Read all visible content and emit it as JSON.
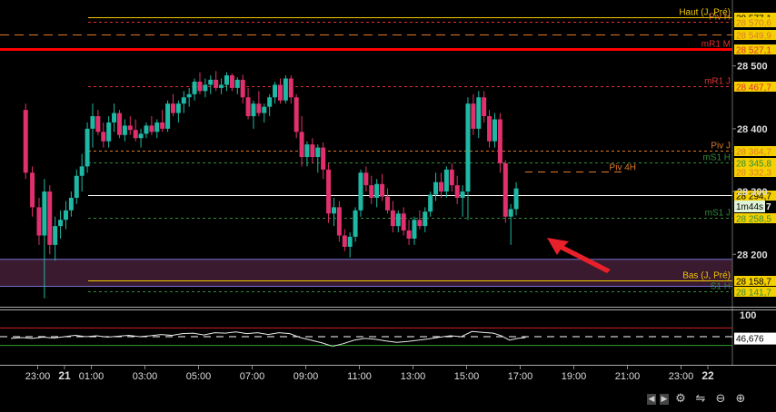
{
  "chart_data": {
    "type": "candlestick",
    "price_axis": {
      "ticks": [
        "28 500",
        "28 400",
        "28 300",
        "28 200"
      ],
      "tick_values": [
        28500,
        28400,
        28300,
        28200
      ],
      "range": [
        28118,
        28605
      ]
    },
    "time_axis": {
      "ticks": [
        "23:00",
        "21",
        "01:00",
        "03:00",
        "05:00",
        "07:00",
        "09:00",
        "11:00",
        "13:00",
        "15:00",
        "17:00",
        "19:00",
        "21:00",
        "23:00",
        "22"
      ],
      "tick_hours": [
        -1,
        0,
        1,
        3,
        5,
        7,
        9,
        11,
        13,
        15,
        17,
        19,
        21,
        23,
        24
      ],
      "bold_ticks": [
        "21",
        "22"
      ]
    },
    "levels": [
      {
        "label": "Haut (J, Pré)",
        "price": 28577.1,
        "tag": "28 577,1",
        "color": "#f0c800",
        "label_color": "#f0c800",
        "style": "solid"
      },
      {
        "label": "Piv H",
        "price": 28570.6,
        "tag": "28 570,6",
        "color": "#e03030",
        "label_color": "#e07a2a",
        "style": "dotted"
      },
      {
        "label": "",
        "price": 28549.9,
        "tag": "28 549,9",
        "color": "#e07a2a",
        "label_color": "#e07a2a",
        "style": "dashed"
      },
      {
        "label": "mR1 M",
        "price": 28527.1,
        "tag": "28 527,1",
        "color": "#ff0000",
        "label_color": "#e03030",
        "style": "thick"
      },
      {
        "label": "mR1 J",
        "price": 28467.7,
        "tag": "28 467,7",
        "color": "#e03030",
        "label_color": "#e03030",
        "style": "dotted"
      },
      {
        "label": "Piv J",
        "price": 28364.7,
        "tag": "28 364,7",
        "color": "#e07a2a",
        "label_color": "#e07a2a",
        "style": "dotted"
      },
      {
        "label": "mS1 H",
        "price": 28345.8,
        "tag": "28 345,8",
        "color": "#2e8b3a",
        "label_color": "#2e8b3a",
        "style": "dotted"
      },
      {
        "label": "Piv 4H",
        "price": 28332.3,
        "tag": "28 332,3",
        "color": "#e07a2a",
        "label_color": "#e07a2a",
        "style": "dashed_short"
      },
      {
        "label": "",
        "price": 28294.7,
        "tag": "28 294,7",
        "color": "#ffffff",
        "label_color": "#ffffff",
        "style": "solid"
      },
      {
        "label": "mS1 J",
        "price": 28258.5,
        "tag": "28 258,5",
        "color": "#2e8b3a",
        "label_color": "#2e8b3a",
        "style": "dotted"
      },
      {
        "label": "Bas (J, Pré)",
        "price": 28158.7,
        "tag": "28 158,7",
        "color": "#f0c800",
        "label_color": "#f0c800",
        "style": "solid"
      },
      {
        "label": "S1 H",
        "price": 28141.7,
        "tag": "28 141,7",
        "color": "#2e8b3a",
        "label_color": "#2e8b3a",
        "style": "dotted"
      }
    ],
    "countdown_tag": "1m44s",
    "zone": {
      "from": 28149,
      "to": 28192,
      "color": "#3a1a2e",
      "border": "#7070d0"
    },
    "arrow_color": "#e8202a",
    "candles": [
      [
        -1.45,
        28430,
        28440,
        28320,
        28330
      ],
      [
        -1.2,
        28330,
        28340,
        28260,
        28275
      ],
      [
        -0.95,
        28275,
        28290,
        28215,
        28230
      ],
      [
        -0.75,
        28230,
        28320,
        28130,
        28300
      ],
      [
        -0.55,
        28300,
        28310,
        28200,
        28215
      ],
      [
        -0.35,
        28215,
        28260,
        28190,
        28245
      ],
      [
        -0.15,
        28245,
        28270,
        28225,
        28255
      ],
      [
        0.05,
        28255,
        28285,
        28240,
        28270
      ],
      [
        0.25,
        28270,
        28300,
        28260,
        28290
      ],
      [
        0.45,
        28290,
        28335,
        28280,
        28325
      ],
      [
        0.65,
        28325,
        28360,
        28300,
        28340
      ],
      [
        0.85,
        28340,
        28410,
        28330,
        28400
      ],
      [
        1.05,
        28400,
        28440,
        28370,
        28420
      ],
      [
        1.25,
        28420,
        28430,
        28390,
        28395
      ],
      [
        1.45,
        28395,
        28410,
        28370,
        28380
      ],
      [
        1.65,
        28380,
        28420,
        28370,
        28410
      ],
      [
        1.85,
        28410,
        28440,
        28395,
        28425
      ],
      [
        2.05,
        28425,
        28430,
        28385,
        28390
      ],
      [
        2.25,
        28390,
        28415,
        28380,
        28405
      ],
      [
        2.45,
        28405,
        28420,
        28390,
        28398
      ],
      [
        2.65,
        28398,
        28415,
        28380,
        28385
      ],
      [
        2.85,
        28385,
        28400,
        28370,
        28392
      ],
      [
        3.05,
        28392,
        28410,
        28385,
        28405
      ],
      [
        3.25,
        28405,
        28420,
        28390,
        28395
      ],
      [
        3.45,
        28395,
        28415,
        28385,
        28410
      ],
      [
        3.65,
        28410,
        28430,
        28395,
        28400
      ],
      [
        3.85,
        28400,
        28445,
        28395,
        28440
      ],
      [
        4.05,
        28440,
        28455,
        28420,
        28425
      ],
      [
        4.25,
        28425,
        28445,
        28410,
        28440
      ],
      [
        4.45,
        28440,
        28460,
        28425,
        28450
      ],
      [
        4.65,
        28450,
        28465,
        28435,
        28455
      ],
      [
        4.85,
        28455,
        28480,
        28445,
        28475
      ],
      [
        5.05,
        28475,
        28490,
        28455,
        28460
      ],
      [
        5.25,
        28460,
        28480,
        28450,
        28470
      ],
      [
        5.45,
        28470,
        28485,
        28455,
        28478
      ],
      [
        5.65,
        28478,
        28492,
        28460,
        28465
      ],
      [
        5.85,
        28465,
        28480,
        28455,
        28470
      ],
      [
        6.05,
        28470,
        28490,
        28460,
        28485
      ],
      [
        6.25,
        28485,
        28488,
        28460,
        28465
      ],
      [
        6.45,
        28465,
        28482,
        28455,
        28478
      ],
      [
        6.65,
        28478,
        28486,
        28440,
        28450
      ],
      [
        6.85,
        28450,
        28465,
        28415,
        28420
      ],
      [
        7.05,
        28420,
        28445,
        28400,
        28440
      ],
      [
        7.25,
        28440,
        28460,
        28420,
        28425
      ],
      [
        7.45,
        28425,
        28440,
        28410,
        28435
      ],
      [
        7.65,
        28435,
        28455,
        28420,
        28450
      ],
      [
        7.85,
        28450,
        28475,
        28440,
        28470
      ],
      [
        8.05,
        28470,
        28480,
        28440,
        28445
      ],
      [
        8.25,
        28445,
        28485,
        28440,
        28480
      ],
      [
        8.45,
        28480,
        28485,
        28440,
        28450
      ],
      [
        8.65,
        28450,
        28455,
        28385,
        28395
      ],
      [
        8.85,
        28395,
        28420,
        28340,
        28355
      ],
      [
        9.05,
        28355,
        28380,
        28340,
        28375
      ],
      [
        9.25,
        28375,
        28385,
        28345,
        28355
      ],
      [
        9.45,
        28355,
        28375,
        28330,
        28370
      ],
      [
        9.65,
        28370,
        28378,
        28320,
        28335
      ],
      [
        9.85,
        28335,
        28345,
        28250,
        28265
      ],
      [
        10.05,
        28265,
        28290,
        28245,
        28275
      ],
      [
        10.25,
        28275,
        28285,
        28220,
        28230
      ],
      [
        10.45,
        28230,
        28240,
        28205,
        28212
      ],
      [
        10.65,
        28212,
        28235,
        28195,
        28228
      ],
      [
        10.85,
        28228,
        28275,
        28220,
        28270
      ],
      [
        11.05,
        28270,
        28335,
        28260,
        28330
      ],
      [
        11.25,
        28330,
        28340,
        28300,
        28310
      ],
      [
        11.45,
        28310,
        28325,
        28280,
        28290
      ],
      [
        11.65,
        28290,
        28320,
        28275,
        28312
      ],
      [
        11.85,
        28312,
        28328,
        28285,
        28292
      ],
      [
        12.05,
        28292,
        28305,
        28265,
        28270
      ],
      [
        12.25,
        28270,
        28285,
        28235,
        28245
      ],
      [
        12.45,
        28245,
        28270,
        28235,
        28265
      ],
      [
        12.65,
        28265,
        28275,
        28230,
        28238
      ],
      [
        12.85,
        28238,
        28255,
        28215,
        28225
      ],
      [
        13.05,
        28225,
        28260,
        28215,
        28255
      ],
      [
        13.25,
        28255,
        28270,
        28240,
        28245
      ],
      [
        13.45,
        28245,
        28275,
        28235,
        28268
      ],
      [
        13.65,
        28268,
        28300,
        28260,
        28295
      ],
      [
        13.85,
        28295,
        28330,
        28285,
        28315
      ],
      [
        14.05,
        28315,
        28330,
        28290,
        28300
      ],
      [
        14.25,
        28300,
        28340,
        28290,
        28335
      ],
      [
        14.45,
        28335,
        28345,
        28300,
        28310
      ],
      [
        14.65,
        28310,
        28325,
        28280,
        28290
      ],
      [
        14.85,
        28290,
        28310,
        28260,
        28300
      ],
      [
        15.05,
        28300,
        28450,
        28255,
        28440
      ],
      [
        15.25,
        28440,
        28455,
        28390,
        28400
      ],
      [
        15.45,
        28400,
        28460,
        28385,
        28450
      ],
      [
        15.65,
        28450,
        28460,
        28410,
        28420
      ],
      [
        15.85,
        28420,
        28430,
        28370,
        28380
      ],
      [
        16.05,
        28380,
        28425,
        28370,
        28415
      ],
      [
        16.25,
        28415,
        28425,
        28330,
        28345
      ],
      [
        16.45,
        28345,
        28350,
        28250,
        28260
      ],
      [
        16.65,
        28260,
        28280,
        28215,
        28272
      ],
      [
        16.85,
        28272,
        28315,
        28262,
        28305
      ]
    ],
    "indicator": {
      "top_label": "100",
      "value_tag": "46,676",
      "range": [
        0,
        100
      ],
      "upper_band": 70,
      "lower_band": 30,
      "dash_level": 50,
      "values": [
        [
          -2.0,
          46
        ],
        [
          -1.6,
          48
        ],
        [
          -1.2,
          46
        ],
        [
          -0.8,
          49
        ],
        [
          -0.4,
          47
        ],
        [
          0.0,
          50
        ],
        [
          0.4,
          53
        ],
        [
          0.8,
          50
        ],
        [
          1.2,
          52
        ],
        [
          1.6,
          49
        ],
        [
          2.0,
          51
        ],
        [
          2.4,
          53
        ],
        [
          2.8,
          50
        ],
        [
          3.2,
          52
        ],
        [
          3.6,
          55
        ],
        [
          4.0,
          53
        ],
        [
          4.4,
          57
        ],
        [
          4.8,
          58
        ],
        [
          5.2,
          54
        ],
        [
          5.6,
          59
        ],
        [
          6.0,
          58
        ],
        [
          6.4,
          61
        ],
        [
          6.8,
          57
        ],
        [
          7.2,
          59
        ],
        [
          7.6,
          55
        ],
        [
          8.0,
          59
        ],
        [
          8.4,
          57
        ],
        [
          8.8,
          48
        ],
        [
          9.2,
          42
        ],
        [
          9.6,
          36
        ],
        [
          10.0,
          28
        ],
        [
          10.4,
          34
        ],
        [
          10.8,
          42
        ],
        [
          11.2,
          46
        ],
        [
          11.6,
          44
        ],
        [
          12.0,
          40
        ],
        [
          12.4,
          37
        ],
        [
          12.8,
          39
        ],
        [
          13.2,
          42
        ],
        [
          13.6,
          45
        ],
        [
          14.0,
          49
        ],
        [
          14.4,
          52
        ],
        [
          14.8,
          50
        ],
        [
          15.2,
          62
        ],
        [
          15.6,
          60
        ],
        [
          16.0,
          58
        ],
        [
          16.3,
          52
        ],
        [
          16.6,
          42
        ],
        [
          16.9,
          46
        ],
        [
          17.2,
          48
        ]
      ]
    }
  }
}
